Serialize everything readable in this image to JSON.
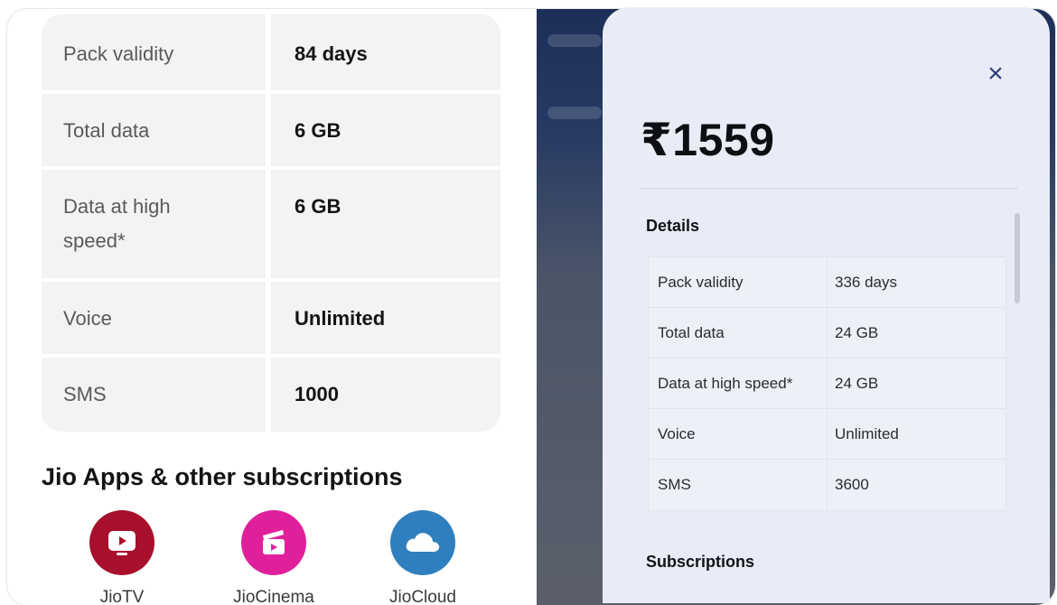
{
  "left_plan": {
    "rows": [
      {
        "label": "Pack validity",
        "value": "84 days"
      },
      {
        "label": "Total data",
        "value": "6 GB"
      },
      {
        "label": "Data at high speed*",
        "value": "6 GB"
      },
      {
        "label": "Voice",
        "value": "Unlimited"
      },
      {
        "label": "SMS",
        "value": "1000"
      }
    ],
    "apps_title": "Jio Apps & other subscriptions",
    "apps": [
      {
        "name": "JioTV",
        "icon": "tv-icon",
        "color": "#a80f2c"
      },
      {
        "name": "JioCinema",
        "icon": "clapperboard-icon",
        "color": "#e0209a"
      },
      {
        "name": "JioCloud",
        "icon": "cloud-icon",
        "color": "#2f7fbe"
      }
    ]
  },
  "modal": {
    "price": "₹1559",
    "close_label": "×",
    "details_heading": "Details",
    "rows": [
      {
        "label": "Pack validity",
        "value": "336 days"
      },
      {
        "label": "Total data",
        "value": "24 GB"
      },
      {
        "label": "Data at high speed*",
        "value": "24 GB"
      },
      {
        "label": "Voice",
        "value": "Unlimited"
      },
      {
        "label": "SMS",
        "value": "3600"
      }
    ],
    "subscriptions_heading": "Subscriptions"
  },
  "colors": {
    "accent_blue": "#2b3c7a",
    "jiotv_red": "#a80f2c",
    "jiocinema_pink": "#e0209a",
    "jiocloud_blue": "#2f7fbe"
  }
}
